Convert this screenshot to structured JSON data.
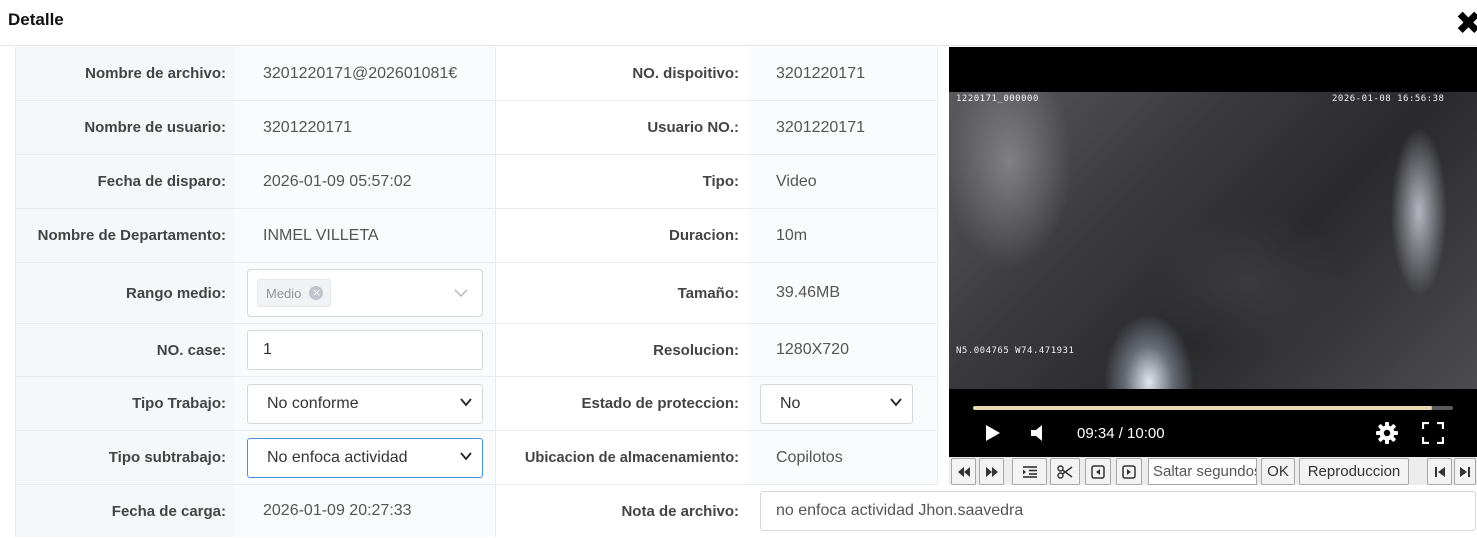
{
  "dialog": {
    "title": "Detalle",
    "close_glyph": "✖"
  },
  "fields": {
    "nombre_archivo": {
      "label": "Nombre de archivo:",
      "value": "3201220171@202601081€"
    },
    "no_dispositivo": {
      "label": "NO. dispoitivo:",
      "value": "3201220171"
    },
    "nombre_usuario": {
      "label": "Nombre de usuario:",
      "value": "3201220171"
    },
    "usuario_no": {
      "label": "Usuario NO.:",
      "value": "3201220171"
    },
    "fecha_disparo": {
      "label": "Fecha de disparo:",
      "value": "2026-01-09 05:57:02"
    },
    "tipo": {
      "label": "Tipo:",
      "value": "Video"
    },
    "departamento": {
      "label": "Nombre de Departamento:",
      "value": "INMEL VILLETA"
    },
    "duracion": {
      "label": "Duracion:",
      "value": "10m"
    },
    "rango_medio": {
      "label": "Rango medio:",
      "tag": "Medio"
    },
    "tamano": {
      "label": "Tamaño:",
      "value": "39.46MB"
    },
    "no_case": {
      "label": "NO. case:",
      "value": "1"
    },
    "resolucion": {
      "label": "Resolucion:",
      "value": "1280X720"
    },
    "tipo_trabajo": {
      "label": "Tipo Trabajo:",
      "value": "No conforme"
    },
    "estado_proteccion": {
      "label": "Estado de proteccion:",
      "value": "No"
    },
    "tipo_subtrabajo": {
      "label": "Tipo subtrabajo:",
      "value": "No enfoca actividad"
    },
    "ubicacion": {
      "label": "Ubicacion de almacenamiento:",
      "value": "Copilotos"
    },
    "fecha_carga": {
      "label": "Fecha de carga:",
      "value": "2026-01-09 20:27:33"
    },
    "nota": {
      "label": "Nota de archivo:",
      "value": "no enfoca actividad Jhon.saavedra"
    }
  },
  "player": {
    "overlay_device": "1220171_000000",
    "overlay_datetime": "2026-01-08 16:56:38",
    "overlay_gps": "N5.004765 W74.471931",
    "current_time": "09:34",
    "total_time": "10:00",
    "time_display": "09:34 / 10:00",
    "progress_fraction": 0.957,
    "progress_color": "#e8d9b0",
    "icons": [
      "play-icon",
      "volume-icon",
      "settings-icon",
      "fullscreen-icon"
    ]
  },
  "toolbar": {
    "seek_placeholder": "Saltar segundos",
    "ok_label": "OK",
    "playback_label": "Reproduccion",
    "icons": [
      "rewind-icon",
      "fast-forward-icon",
      "list-indent-icon",
      "scissors-icon",
      "frame-back-icon",
      "frame-forward-icon",
      "skip-start-icon",
      "skip-end-icon"
    ]
  }
}
